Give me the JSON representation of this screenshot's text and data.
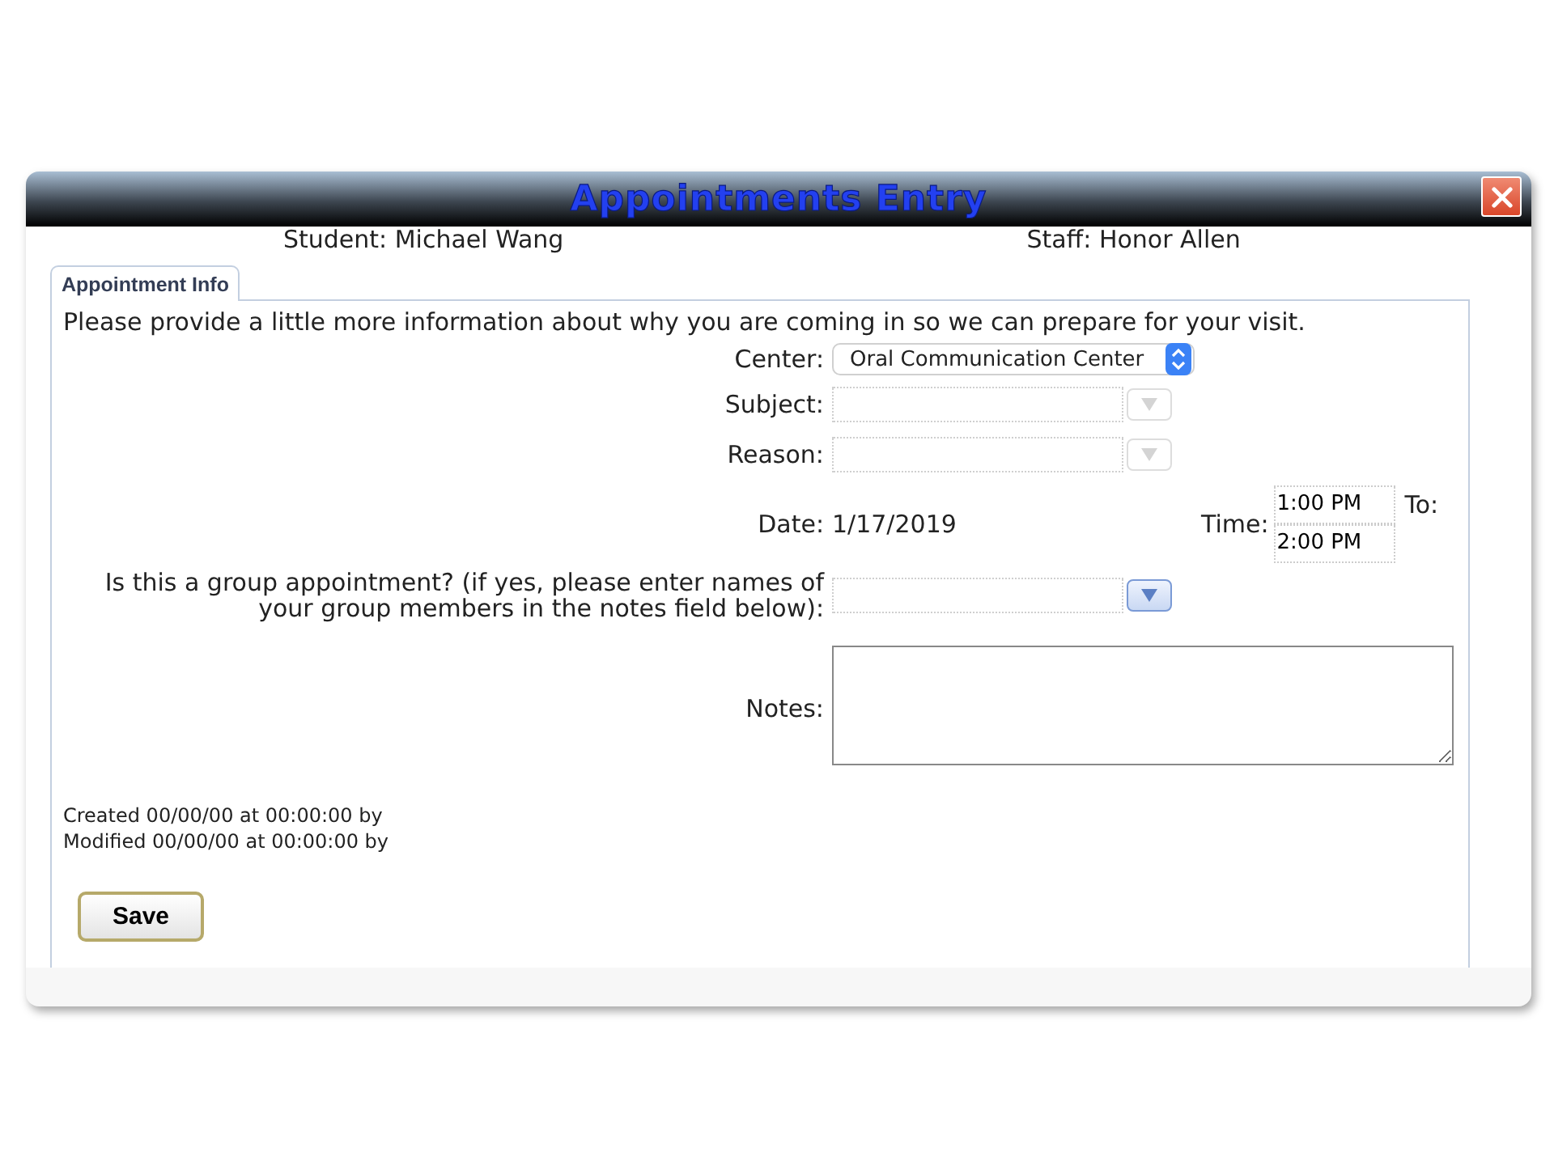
{
  "window": {
    "title": "Appointments Entry"
  },
  "header": {
    "student": "Student: Michael Wang",
    "staff": "Staff: Honor Allen"
  },
  "tabs": [
    {
      "label": "Appointment Info",
      "selected": true
    }
  ],
  "intro": "Please provide a little more information about why you are coming in so we can prepare for your visit.",
  "fields": [
    {
      "kind": "select",
      "label": "Center:",
      "value": "Oral Communication Center",
      "disabled": false
    },
    {
      "kind": "combo",
      "label": "Subject:",
      "disabled": true
    },
    {
      "kind": "combo",
      "label": "Reason:",
      "disabled": true
    },
    {
      "kind": "datetime",
      "label": "Date:",
      "value": "1/17/2019",
      "time_label": "Time:",
      "start": "1:00 PM",
      "end_label": "To:",
      "end": "2:00 PM"
    },
    {
      "kind": "combo",
      "label": "Is this a group appointment? (if yes, please enter names of your group members in the notes field below):",
      "disabled": false
    },
    {
      "kind": "textarea",
      "label": "Notes:"
    }
  ],
  "audit": [
    "Created 00/00/00 at 00:00:00 by",
    "Modified 00/00/00 at 00:00:00 by"
  ],
  "buttons": [
    {
      "label": "Save"
    }
  ]
}
